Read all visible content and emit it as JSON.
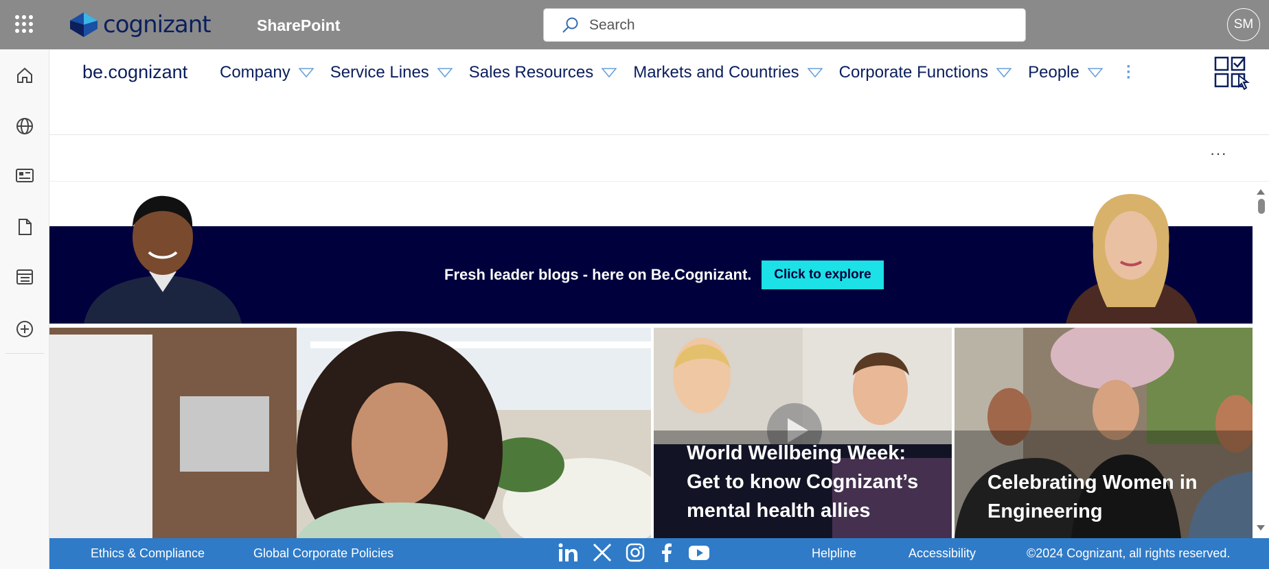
{
  "topbar": {
    "brand": "cognizant",
    "app_name": "SharePoint",
    "search_placeholder": "Search",
    "user_initials": "SM"
  },
  "site": {
    "name": "be.cognizant",
    "menu": [
      {
        "label": "Company"
      },
      {
        "label": "Service Lines"
      },
      {
        "label": "Sales Resources"
      },
      {
        "label": "Markets and Countries"
      },
      {
        "label": "Corporate Functions"
      },
      {
        "label": "People"
      }
    ]
  },
  "banner": {
    "text": "Fresh leader blogs - here on Be.Cognizant.",
    "button": "Click to explore"
  },
  "tiles": [
    {
      "title": ""
    },
    {
      "title": "World Wellbeing Week: Get to know Cognizant’s mental health allies"
    },
    {
      "title": "Celebrating Women in Engineering"
    }
  ],
  "footer": {
    "ethics": "Ethics & Compliance",
    "policies": "Global Corporate Policies",
    "helpline": "Helpline",
    "accessibility": "Accessibility",
    "copyright": "©2024 Cognizant, all rights reserved."
  },
  "colors": {
    "topbar": "#8a8a8a",
    "nav_text": "#0a1e5c",
    "banner_bg": "#00003d",
    "banner_button": "#1ce1e6",
    "footer_bg": "#2f7bc8"
  }
}
